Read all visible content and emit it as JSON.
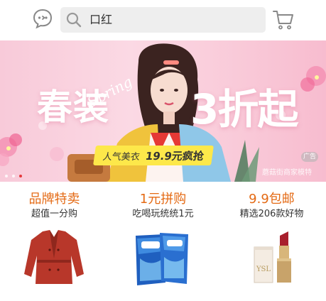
{
  "header": {
    "search_value": "口红"
  },
  "banner": {
    "title_left": "春装",
    "script_word": "Spring",
    "title_right": "3折起",
    "tag_left": "人气美衣",
    "tag_right": "19.9元疯抢",
    "watermark": "蘑菇街商家模特",
    "ad_label": "广告",
    "slides": 3,
    "active_slide": 3
  },
  "promos": [
    {
      "title": "品牌特卖",
      "subtitle": "超值一分购",
      "product_icon": "red-coat-icon"
    },
    {
      "title": "1元拼购",
      "subtitle": "吃喝玩统统1元",
      "product_icon": "detergent-bags-icon"
    },
    {
      "title": "9.9包邮",
      "subtitle": "精选206款好物",
      "product_icon": "lipstick-icon"
    }
  ],
  "colors": {
    "promo_title": "#e46a14",
    "search_bg": "#eeeeee",
    "banner_pink": "#f9c9d8",
    "tag_yellow": "#fde84a",
    "active_dot": "#e4393c"
  }
}
